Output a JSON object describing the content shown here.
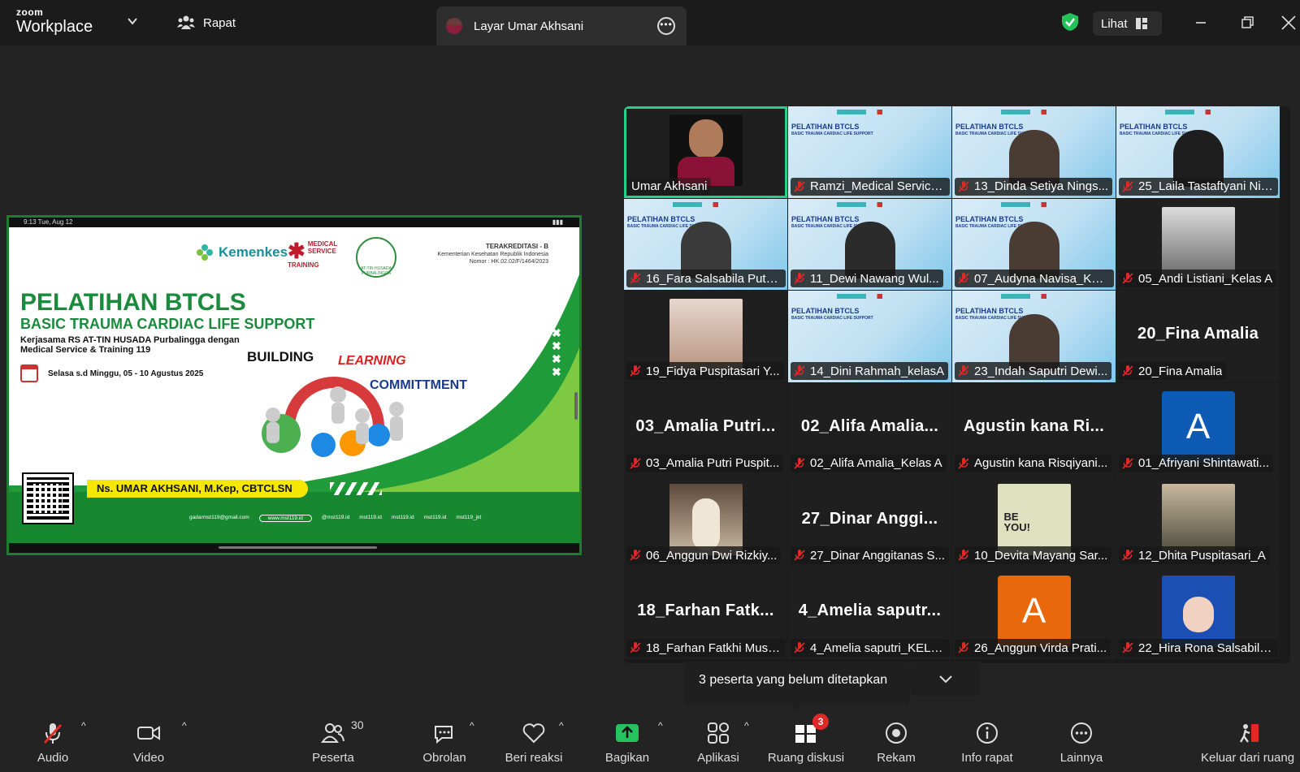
{
  "app": {
    "logo_small": "zoom",
    "logo_big": "Workplace"
  },
  "topbar": {
    "meeting_label": "Rapat",
    "share_tab_label": "Layar Umar Akhsani",
    "view_label": "Lihat"
  },
  "slide": {
    "status_time": "9:13  Tue, Aug 12",
    "kemenkes": "Kemenkes",
    "mst_line1": "MEDICAL",
    "mst_line2": "SERVICE",
    "mst_line3": "TRAINING",
    "atin": "AT-TIN HUSADA PURBALINGGA",
    "accr_title": "TERAKREDITASI - B",
    "accr_line1": "Kementerian Kesehatan Republik Indonesia",
    "accr_line2": "Nomor : HK.02.02/F/1464/2023",
    "title1": "PELATIHAN BTCLS",
    "title2": "BASIC TRAUMA CARDIAC LIFE SUPPORT",
    "subtitle": "Kerjasama RS AT-TIN HUSADA Purbalingga dengan Medical Service & Training 119",
    "date": "Selasa s.d Minggu, 05 - 10 Agustus 2025",
    "word_building": "BUILDING",
    "word_learning": "LEARNING",
    "word_commitment": "COMMITTMENT",
    "presenter": "Ns. UMAR AKHSANI, M.Kep, CBTCLSN",
    "footer_email": "gadarmst119@gmail.com",
    "footer_web": "www.mst119.id",
    "footer_ig": "@mst119.id",
    "footer_fb": "mst119.id",
    "footer_tw": "mst119.id",
    "footer_yt": "mst119.id",
    "footer_tt": "mst119_jkt"
  },
  "gallery": [
    {
      "label": "Umar Akhsani",
      "kind": "cam-presenter",
      "muted": false,
      "active": true
    },
    {
      "label": "Ramzi_Medical Service...",
      "kind": "slide",
      "muted": true
    },
    {
      "label": "13_Dinda Setiya Nings...",
      "kind": "slide-person",
      "muted": true
    },
    {
      "label": "25_Laila Tastaftyani Ningr...",
      "kind": "slide-person",
      "muted": true
    },
    {
      "label": "16_Fara Salsabila Putri...",
      "kind": "slide-person",
      "muted": true
    },
    {
      "label": "11_Dewi Nawang Wul...",
      "kind": "slide-person",
      "muted": true
    },
    {
      "label": "07_Audyna Navisa_Kel...",
      "kind": "slide-person",
      "muted": true
    },
    {
      "label": "05_Andi Listiani_Kelas A",
      "kind": "cam-dim",
      "muted": true
    },
    {
      "label": "19_Fidya Puspitasari Y...",
      "kind": "cam-skin",
      "muted": true
    },
    {
      "label": "14_Dini Rahmah_kelasA",
      "kind": "slide",
      "muted": true
    },
    {
      "label": "23_Indah Saputri Dewi...",
      "kind": "slide-person",
      "muted": true
    },
    {
      "label": "20_Fina Amalia",
      "kind": "name",
      "bigname": "20_Fina Amalia",
      "muted": true
    },
    {
      "label": "03_Amalia Putri Puspit...",
      "kind": "name",
      "bigname": "03_Amalia  Putri...",
      "muted": true
    },
    {
      "label": "02_Alifa Amalia_Kelas A",
      "kind": "name",
      "bigname": "02_Alifa  Amalia...",
      "muted": true
    },
    {
      "label": "Agustin kana Risqiyani...",
      "kind": "name",
      "bigname": "Agustin  kana  Ri...",
      "muted": true
    },
    {
      "label": "01_Afriyani Shintawati...",
      "kind": "letter",
      "letter": "A",
      "color": "#0e5bb5",
      "muted": true
    },
    {
      "label": "06_Anggun Dwi Rizkiy...",
      "kind": "cam-photo",
      "muted": true
    },
    {
      "label": "27_Dinar Anggitanas S...",
      "kind": "name",
      "bigname": "27_Dinar  Anggi...",
      "muted": true
    },
    {
      "label": "10_Devita Mayang Sar...",
      "kind": "believe",
      "believe_a": "BE",
      "believe_b": "YOU!",
      "muted": true
    },
    {
      "label": "12_Dhita Puspitasari_A",
      "kind": "cam-tree",
      "muted": true
    },
    {
      "label": "18_Farhan Fatkhi Musy...",
      "kind": "name",
      "bigname": "18_Farhan  Fatk...",
      "muted": true
    },
    {
      "label": "4_Amelia saputri_KELA...",
      "kind": "name",
      "bigname": "4_Amelia  saputr...",
      "muted": true
    },
    {
      "label": "26_Anggun Virda Prati...",
      "kind": "letter",
      "letter": "A",
      "color": "#e8680b",
      "muted": true
    },
    {
      "label": "22_Hira Rona Salsabila...",
      "kind": "cam-hijab",
      "muted": true
    }
  ],
  "popup": {
    "text": "3 peserta yang belum ditetapkan"
  },
  "toolbar": {
    "audio": "Audio",
    "video": "Video",
    "participants": "Peserta",
    "participants_count": "30",
    "chat": "Obrolan",
    "react": "Beri reaksi",
    "share": "Bagikan",
    "apps": "Aplikasi",
    "breakout": "Ruang diskusi",
    "breakout_badge": "3",
    "record": "Rekam",
    "info": "Info rapat",
    "more": "Lainnya",
    "leave": "Keluar dari ruang"
  },
  "colors": {
    "accent_green": "#23d18b",
    "share_green": "#24c35e",
    "muted_red": "#e02828"
  }
}
